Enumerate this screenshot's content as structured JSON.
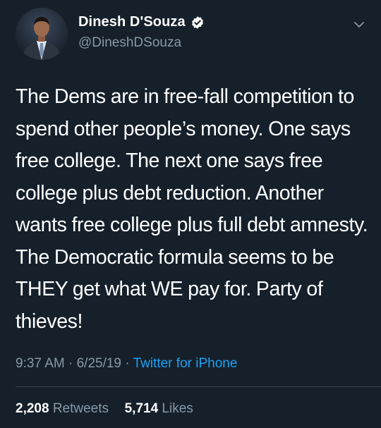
{
  "author": {
    "name": "Dinesh D'Souza",
    "handle": "@DineshDSouza",
    "verified": true
  },
  "tweet": {
    "text": "The Dems are in free-fall competition to spend other people’s money. One says free college. The next one says free college plus debt reduction. Another wants free college plus full debt amnesty. The Democratic formula seems to be THEY get what WE pay for. Party of thieves!",
    "time": "9:37 AM",
    "separator": "·",
    "date": "6/25/19",
    "source": "Twitter for iPhone"
  },
  "stats": {
    "retweets_count": "2,208",
    "retweets_label": "Retweets",
    "likes_count": "5,714",
    "likes_label": "Likes"
  },
  "icons": {
    "verified": "verified-badge-icon",
    "menu": "chevron-down-icon"
  },
  "colors": {
    "background": "#15202b",
    "primary_text": "#ffffff",
    "secondary_text": "#8899a6",
    "link": "#1da1f2",
    "divider": "#38444d"
  }
}
